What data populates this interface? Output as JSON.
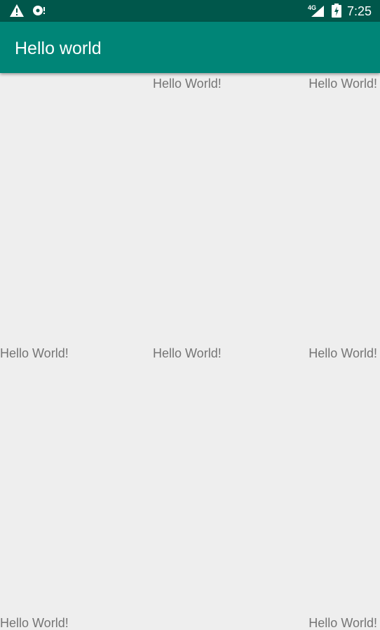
{
  "status_bar": {
    "time": "7:25",
    "network_type": "4G",
    "icons": [
      "warning-icon",
      "sync-icon",
      "signal-icon",
      "battery-charging-icon"
    ],
    "background_color": "#00574b"
  },
  "app_bar": {
    "title": "Hello world",
    "background_color": "#008577"
  },
  "content": {
    "background_color": "#eeeeee",
    "labels": {
      "top_center": "Hello World!",
      "top_right": "Hello World!",
      "middle_left": "Hello World!",
      "middle_center": "Hello World!",
      "middle_right": "Hello World!",
      "bottom_left": "Hello World!",
      "bottom_right": "Hello World!"
    }
  }
}
